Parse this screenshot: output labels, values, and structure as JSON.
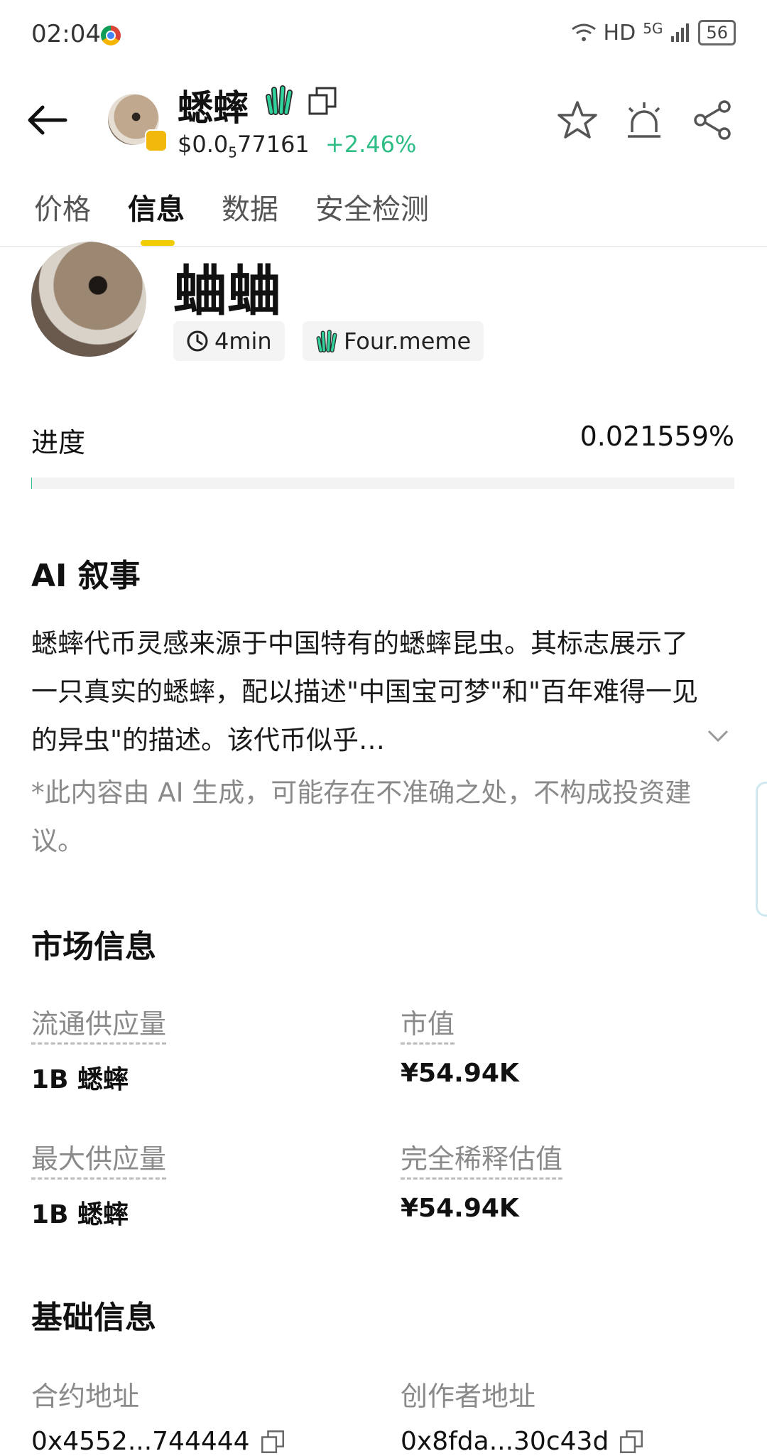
{
  "status_bar": {
    "time": "02:04",
    "network": "HD",
    "signal": "5G",
    "battery": "56"
  },
  "header": {
    "token_name": "蟋蟀",
    "price_prefix": "$0.0",
    "price_sub": "5",
    "price_rest": "77161",
    "change": "+2.46%"
  },
  "tabs": [
    "价格",
    "信息",
    "数据",
    "安全检测"
  ],
  "hero": {
    "name": "蛐蛐",
    "age": "4min",
    "platform": "Four.meme"
  },
  "progress": {
    "label": "进度",
    "value_text": "0.021559%",
    "fraction": 0.00021559
  },
  "ai_narrative": {
    "title": "AI 叙事",
    "text": "蟋蟀代币灵感来源于中国特有的蟋蟀昆虫。其标志展示了一只真实的蟋蟀，配以描述\"中国宝可梦\"和\"百年难得一见的异虫\"的描述。该代币似乎…",
    "disclaimer": "*此内容由 AI 生成，可能存在不准确之处，不构成投资建议。"
  },
  "market_info": {
    "title": "市场信息",
    "circulating_label": "流通供应量",
    "circulating_value": "1B 蟋蟀",
    "market_cap_label": "市值",
    "market_cap_value": "¥54.94K",
    "max_supply_label": "最大供应量",
    "max_supply_value": "1B 蟋蟀",
    "fdv_label": "完全稀释估值",
    "fdv_value": "¥54.94K"
  },
  "basic_info": {
    "title": "基础信息",
    "contract_label": "合约地址",
    "contract_value": "0x4552...744444",
    "creator_label": "创作者地址",
    "creator_value": "0x8fda...30c43d"
  },
  "colors": {
    "positive": "#2ebd85",
    "accent": "#f2cc00",
    "muted": "#8a8a8a"
  }
}
